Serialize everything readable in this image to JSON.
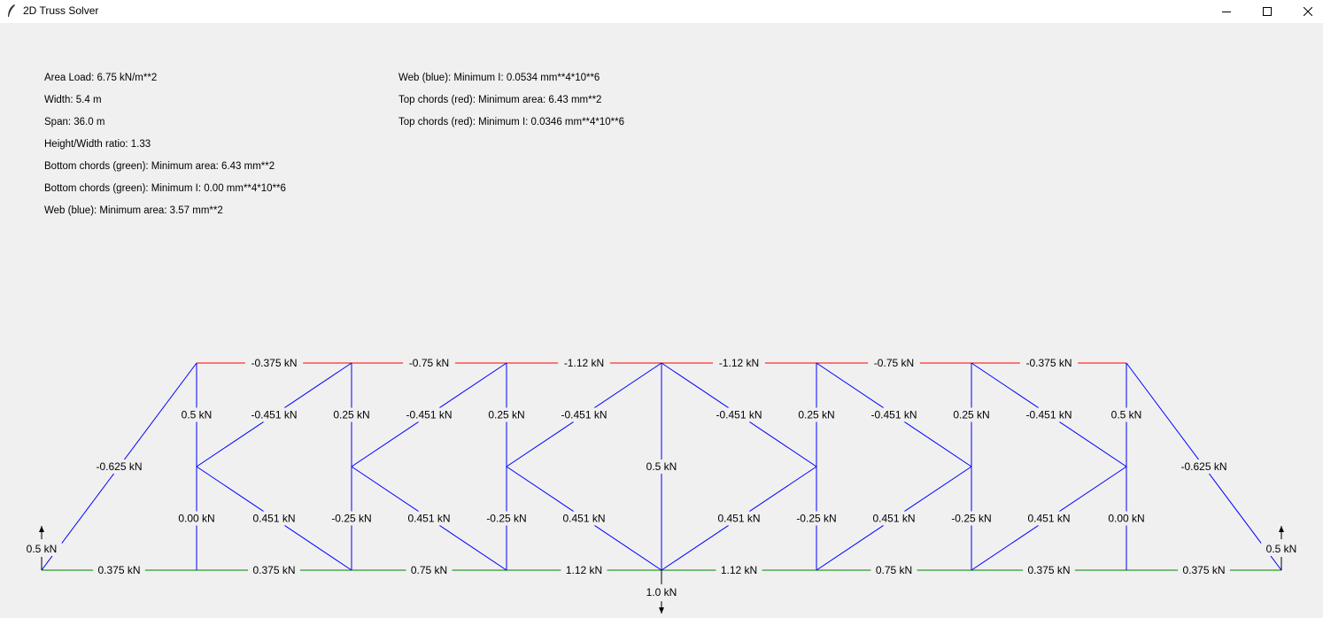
{
  "window": {
    "title": "2D Truss Solver",
    "icon": "feather-icon",
    "controls": [
      "minimize-icon",
      "maximize-icon",
      "close-icon"
    ]
  },
  "info": {
    "left": [
      "Area Load: 6.75 kN/m**2",
      "Width: 5.4 m",
      "Span: 36.0 m",
      "Height/Width ratio: 1.33",
      "Bottom chords (green): Minimum area: 6.43 mm**2",
      "Bottom chords (green): Minimum I: 0.00 mm**4*10**6",
      "Web (blue): Minimum area: 3.57 mm**2"
    ],
    "right": [
      "Web (blue): Minimum I: 0.0534 mm**4*10**6",
      "Top chords (red): Minimum area: 6.43 mm**2",
      "Top chords (red): Minimum I: 0.0346 mm**4*10**6"
    ]
  },
  "colors": {
    "top_chord": "#ff0000",
    "bottom_chord": "#008000",
    "web": "#0000ff",
    "background": "#f0f0f0"
  },
  "truss": {
    "top_chord_labels": [
      "-0.375 kN",
      "-0.75 kN",
      "-1.12 kN",
      "-1.12 kN",
      "-0.75 kN",
      "-0.375 kN"
    ],
    "bottom_chord_labels": [
      "0.375 kN",
      "0.375 kN",
      "0.75 kN",
      "1.12 kN",
      "1.12 kN",
      "0.75 kN",
      "0.375 kN",
      "0.375 kN"
    ],
    "end_diagonal_labels": [
      "-0.625 kN",
      "-0.625 kN"
    ],
    "vertical_upper_labels": [
      "0.5 kN",
      "0.25 kN",
      "0.25 kN",
      "0.25 kN",
      "0.25 kN",
      "0.5 kN"
    ],
    "vertical_lower_labels": [
      "0.00 kN",
      "-0.25 kN",
      "-0.25 kN",
      "-0.25 kN",
      "-0.25 kN",
      "0.00 kN"
    ],
    "center_vertical_label": "0.5 kN",
    "web_upper_labels": [
      "-0.451 kN",
      "-0.451 kN",
      "-0.451 kN",
      "-0.451 kN",
      "-0.451 kN",
      "-0.451 kN"
    ],
    "web_lower_labels": [
      "0.451 kN",
      "0.451 kN",
      "0.451 kN",
      "0.451 kN",
      "0.451 kN",
      "0.451 kN"
    ],
    "reaction_labels": [
      "0.5 kN",
      "0.5 kN"
    ],
    "load_label": "1.0 kN"
  }
}
